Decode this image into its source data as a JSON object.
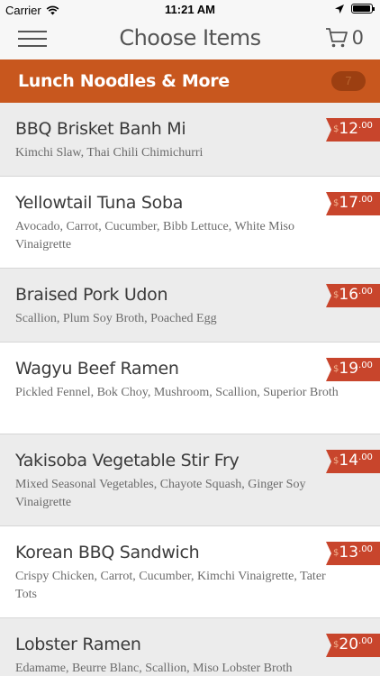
{
  "status_bar": {
    "carrier": "Carrier",
    "time": "11:21 AM"
  },
  "navbar": {
    "title": "Choose Items",
    "cart_count": "0"
  },
  "category": {
    "title": "Lunch Noodles & More",
    "count": "7"
  },
  "items": [
    {
      "name": "BBQ Brisket Banh Mi",
      "description": "Kimchi Slaw, Thai Chili Chimichurri",
      "currency": "$",
      "price_major": "12",
      "price_minor": ".00"
    },
    {
      "name": "Yellowtail Tuna Soba",
      "description": "Avocado, Carrot, Cucumber, Bibb Lettuce, White Miso Vinaigrette",
      "currency": "$",
      "price_major": "17",
      "price_minor": ".00"
    },
    {
      "name": "Braised Pork Udon",
      "description": "Scallion, Plum Soy Broth, Poached Egg",
      "currency": "$",
      "price_major": "16",
      "price_minor": ".00"
    },
    {
      "name": "Wagyu Beef Ramen",
      "description": "Pickled Fennel, Bok Choy, Mushroom, Scallion, Superior Broth",
      "currency": "$",
      "price_major": "19",
      "price_minor": ".00"
    },
    {
      "name": "Yakisoba Vegetable Stir Fry",
      "description": "Mixed Seasonal Vegetables, Chayote Squash, Ginger Soy Vinaigrette",
      "currency": "$",
      "price_major": "14",
      "price_minor": ".00"
    },
    {
      "name": "Korean BBQ Sandwich",
      "description": "Crispy Chicken, Carrot, Cucumber, Kimchi Vinaigrette, Tater Tots",
      "currency": "$",
      "price_major": "13",
      "price_minor": ".00"
    },
    {
      "name": "Lobster Ramen",
      "description": "Edamame, Beurre Blanc, Scallion, Miso Lobster Broth",
      "currency": "$",
      "price_major": "20",
      "price_minor": ".00"
    }
  ],
  "colors": {
    "accent": "#c8571e",
    "price_tag": "#c8452c",
    "row_alt": "#ececec"
  },
  "icons": {
    "menu": "hamburger-icon",
    "cart": "cart-icon",
    "wifi": "wifi-icon",
    "location": "location-arrow-icon",
    "battery": "battery-icon"
  }
}
